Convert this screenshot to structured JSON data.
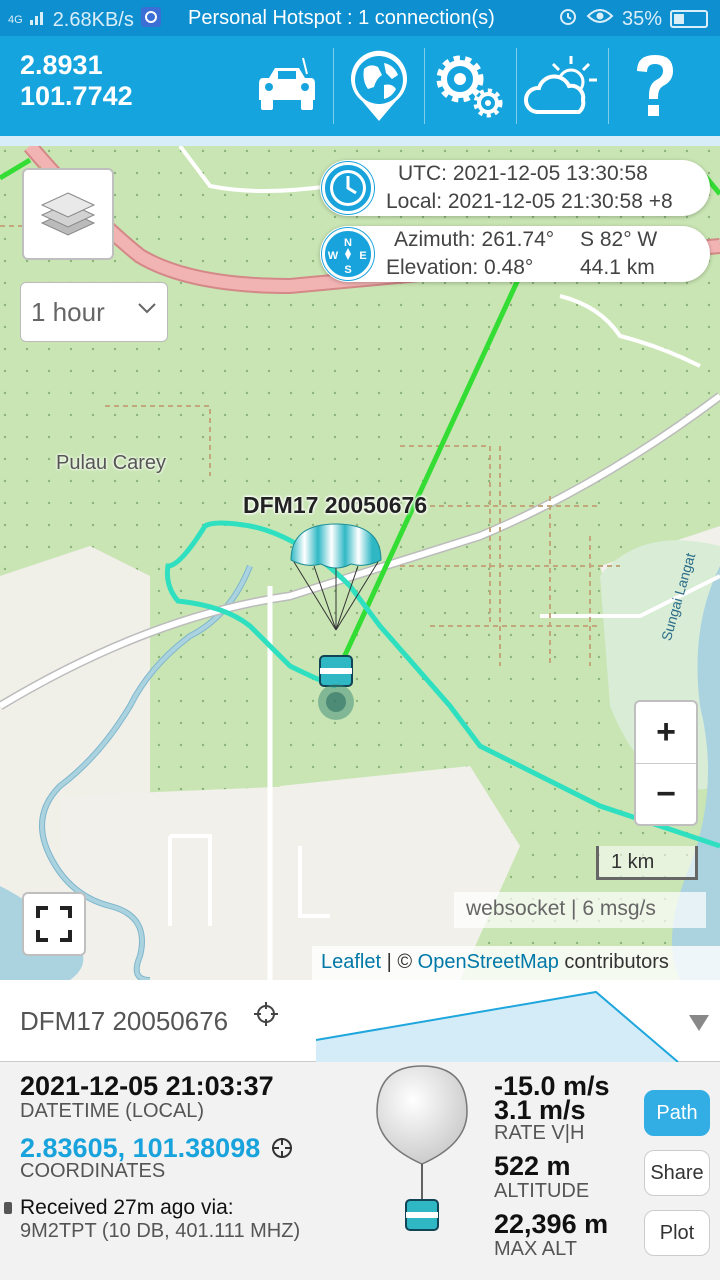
{
  "status_bar": {
    "network": "4G",
    "speed": "2.68KB/s",
    "hotspot": "Personal Hotspot : 1 connection(s)",
    "battery": "35%"
  },
  "header": {
    "lat": "2.8931",
    "lon": "101.7742",
    "icons": [
      "car-icon",
      "globe-pin-icon",
      "gears-icon",
      "weather-icon",
      "help-icon"
    ]
  },
  "map": {
    "place_label": "Pulau Carey",
    "river_label": "Sungai Langat",
    "range_select": "1 hour",
    "time": {
      "utc": "UTC: 2021-12-05 13:30:58",
      "local": "Local: 2021-12-05 21:30:58 +8"
    },
    "look": {
      "azimuth": "Azimuth: 261.74°",
      "direction": "S 82° W",
      "elevation": "Elevation: 0.48°",
      "distance": "44.1 km"
    },
    "balloon_label": "DFM17 20050676",
    "zoom_in": "+",
    "zoom_out": "−",
    "scale": "1 km",
    "websocket": "websocket | 6 msg/s",
    "attribution": {
      "leaflet": "Leaflet",
      "sep": " | © ",
      "osm": "OpenStreetMap",
      "contrib": " contributors"
    },
    "colors": {
      "track": "#2fe0c0",
      "predicted": "#33dd33",
      "accent": "#19a3dc"
    }
  },
  "panel": {
    "title": "DFM17 20050676",
    "datetime": "2021-12-05 21:03:37",
    "datetime_label": "DATETIME (LOCAL)",
    "coordinates": "2.83605, 101.38098",
    "coordinates_label": "COORDINATES",
    "received": "Received 27m ago via:",
    "receiver": "9M2TPT (10 DB, 401.111 MHZ)",
    "rate_v": "-15.0 m/s",
    "rate_h": "3.1 m/s",
    "rate_label": "RATE V|H",
    "altitude": "522 m",
    "altitude_label": "ALTITUDE",
    "max_alt": "22,396 m",
    "max_alt_label": "MAX ALT",
    "buttons": {
      "path": "Path",
      "share": "Share",
      "plot": "Plot"
    }
  }
}
